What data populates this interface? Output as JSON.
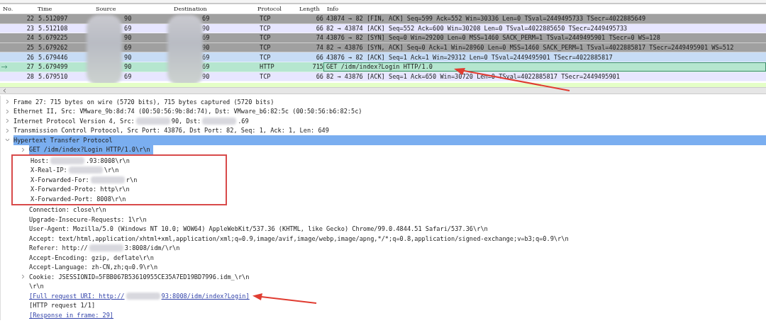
{
  "packet_list": {
    "columns": [
      "No.",
      "Time",
      "Source",
      "Destination",
      "Protocol",
      "Length",
      "Info"
    ],
    "rows": [
      {
        "no": "22",
        "time": "5.512097",
        "source": "90",
        "destination": "69",
        "protocol": "TCP",
        "length": "66",
        "info": "43874 → 82 [FIN, ACK] Seq=599 Ack=552 Win=30336 Len=0 TSval=2449495733 TSecr=4022885649",
        "color": "#a0a0a0",
        "selected": false
      },
      {
        "no": "23",
        "time": "5.512108",
        "source": "69",
        "destination": "90",
        "protocol": "TCP",
        "length": "66",
        "info": "82 → 43874 [ACK] Seq=552 Ack=600 Win=30208 Len=0 TSval=4022885650 TSecr=2449495733",
        "color": "#e7e6ff",
        "selected": false
      },
      {
        "no": "24",
        "time": "5.679225",
        "source": "90",
        "destination": "69",
        "protocol": "TCP",
        "length": "74",
        "info": "43876 → 82 [SYN] Seq=0 Win=29200 Len=0 MSS=1460 SACK_PERM=1 TSval=2449495901 TSecr=0 WS=128",
        "color": "#a0a0a0",
        "selected": false
      },
      {
        "no": "25",
        "time": "5.679262",
        "source": "69",
        "destination": "90",
        "protocol": "TCP",
        "length": "74",
        "info": "82 → 43876 [SYN, ACK] Seq=0 Ack=1 Win=28960 Len=0 MSS=1460 SACK_PERM=1 TSval=4022885817 TSecr=2449495901 WS=512",
        "color": "#a0a0a0",
        "selected": false
      },
      {
        "no": "26",
        "time": "5.679446",
        "source": "90",
        "destination": "69",
        "protocol": "TCP",
        "length": "66",
        "info": "43876 → 82 [ACK] Seq=1 Ack=1 Win=29312 Len=0 TSval=2449495901 TSecr=4022885817",
        "color": "#c7dcf5",
        "selected": false
      },
      {
        "no": "27",
        "time": "5.679499",
        "source": "90",
        "destination": "69",
        "protocol": "HTTP",
        "length": "715",
        "info": "GET /idm/index?Login HTTP/1.0",
        "color": "#b5e6cf",
        "selected": true
      },
      {
        "no": "28",
        "time": "5.679510",
        "source": "69",
        "destination": "90",
        "protocol": "TCP",
        "length": "66",
        "info": "82 → 43876 [ACK] Seq=1 Ack=650 Win=30720 Len=0 TSval=4022885817 TSecr=2449495901",
        "color": "#e7e6ff",
        "selected": false
      }
    ]
  },
  "details": [
    {
      "parts": [
        "Frame 27: 715 bytes on wire (5720 bits), 715 bytes captured (5720 bits)"
      ],
      "expanded": false,
      "selected": false
    },
    {
      "parts": [
        "Ethernet II, Src: VMware_9b:8d:74 (00:50:56:9b:8d:74), Dst: VMware_b6:82:5c (00:50:56:b6:82:5c)"
      ],
      "expanded": false,
      "selected": false
    },
    {
      "parts": [
        "Internet Protocol Version 4, Src:",
        "90, Dst:",
        ".69"
      ],
      "expanded": false,
      "selected": false
    },
    {
      "parts": [
        "Transmission Control Protocol, Src Port: 43876, Dst Port: 82, Seq: 1, Ack: 1, Len: 649"
      ],
      "expanded": false,
      "selected": false
    },
    {
      "parts": [
        "Hypertext Transfer Protocol"
      ],
      "expanded": true,
      "selected": true,
      "children": [
        {
          "parts": [
            "GET /idm/index?Login HTTP/1.0\\r\\n"
          ],
          "expanded": false,
          "selected": true,
          "kind": "branch",
          "boxed": false
        },
        {
          "parts": [
            "Host:",
            ".93:8008\\r\\n"
          ],
          "kind": "leaf",
          "boxed": true,
          "selected": false
        },
        {
          "parts": [
            "X-Real-IP:",
            "\\r\\n"
          ],
          "kind": "leaf",
          "boxed": true,
          "selected": false
        },
        {
          "parts": [
            "X-Forwarded-For:",
            "r\\n"
          ],
          "kind": "leaf",
          "boxed": true,
          "selected": false
        },
        {
          "parts": [
            "X-Forwarded-Proto: http\\r\\n"
          ],
          "kind": "leaf",
          "boxed": true,
          "selected": false
        },
        {
          "parts": [
            "X-Forwarded-Port: 8008\\r\\n"
          ],
          "kind": "leaf",
          "boxed": true,
          "selected": false
        },
        {
          "parts": [
            "Connection: close\\r\\n"
          ],
          "kind": "leaf",
          "boxed": false,
          "selected": false
        },
        {
          "parts": [
            "Upgrade-Insecure-Requests: 1\\r\\n"
          ],
          "kind": "leaf",
          "boxed": false,
          "selected": false
        },
        {
          "parts": [
            "User-Agent: Mozilla/5.0 (Windows NT 10.0; WOW64) AppleWebKit/537.36 (KHTML, like Gecko) Chrome/99.0.4844.51 Safari/537.36\\r\\n"
          ],
          "kind": "leaf",
          "boxed": false,
          "selected": false
        },
        {
          "parts": [
            "Accept: text/html,application/xhtml+xml,application/xml;q=0.9,image/avif,image/webp,image/apng,*/*;q=0.8,application/signed-exchange;v=b3;q=0.9\\r\\n"
          ],
          "kind": "leaf",
          "boxed": false,
          "selected": false
        },
        {
          "parts": [
            "Referer: http://",
            "3:8008/idm/\\r\\n"
          ],
          "kind": "leaf",
          "boxed": false,
          "selected": false
        },
        {
          "parts": [
            "Accept-Encoding: gzip, deflate\\r\\n"
          ],
          "kind": "leaf",
          "boxed": false,
          "selected": false
        },
        {
          "parts": [
            "Accept-Language: zh-CN,zh;q=0.9\\r\\n"
          ],
          "kind": "leaf",
          "boxed": false,
          "selected": false
        },
        {
          "parts": [
            "Cookie: JSESSIONID=5FBB067B53610955CE35A7ED19BD7996.idm_\\r\\n"
          ],
          "expanded": false,
          "kind": "branch",
          "boxed": false,
          "selected": false
        },
        {
          "parts": [
            "\\r\\n"
          ],
          "kind": "leaf",
          "boxed": false,
          "selected": false
        },
        {
          "parts": [
            "[Full request URI: http://",
            "93:8008/idm/index?Login]"
          ],
          "kind": "link",
          "boxed": false,
          "selected": false
        },
        {
          "parts": [
            "[HTTP request 1/1]"
          ],
          "kind": "leaf",
          "boxed": false,
          "selected": false
        },
        {
          "parts": [
            "[Response in frame: 29]"
          ],
          "kind": "link",
          "boxed": false,
          "selected": false
        }
      ]
    }
  ]
}
